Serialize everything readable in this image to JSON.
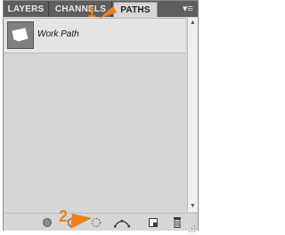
{
  "tabs": [
    {
      "label": "LAYERS"
    },
    {
      "label": "CHANNELS"
    },
    {
      "label": "PATHS",
      "active": true
    }
  ],
  "panel_menu_icon": "panel-menu-icon",
  "paths": [
    {
      "label": "Work Path"
    }
  ],
  "annotations": {
    "marker1": "1",
    "marker2": "2",
    "color": "#ef7f1a"
  },
  "bottom_icons": [
    "fill-path-icon",
    "stroke-path-icon",
    "load-selection-icon",
    "make-work-path-icon",
    "new-path-icon",
    "delete-path-icon"
  ]
}
